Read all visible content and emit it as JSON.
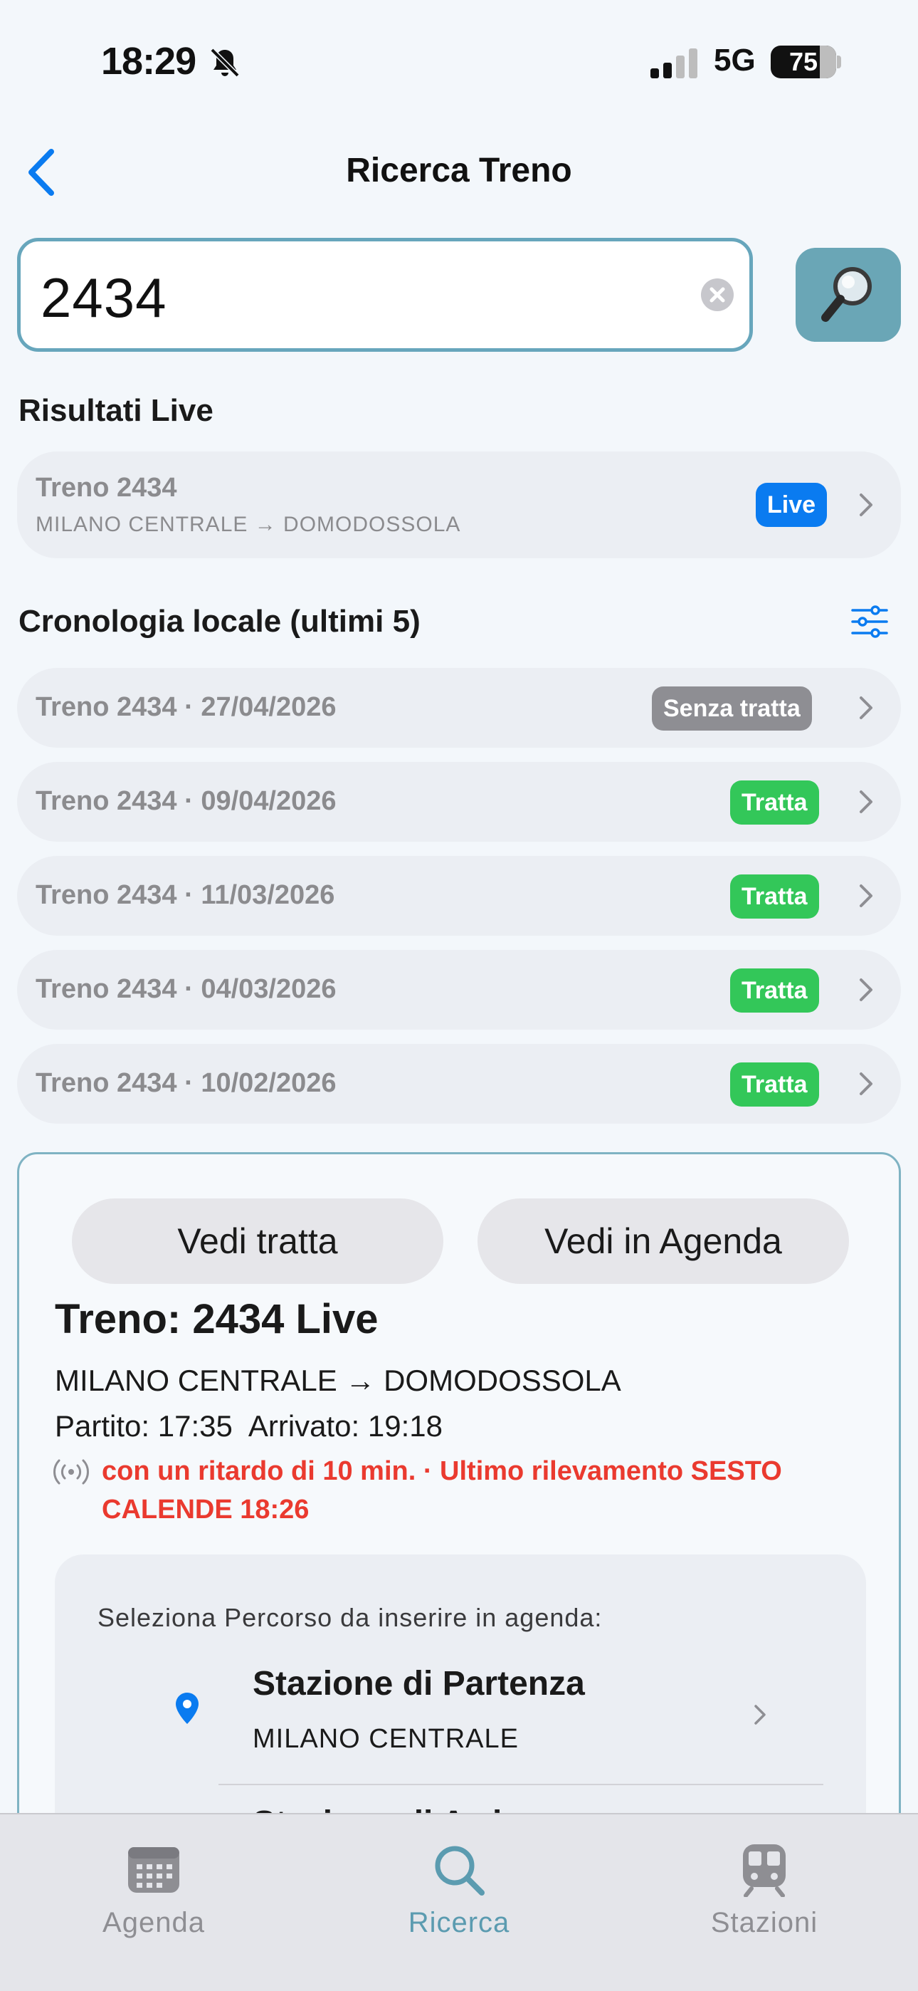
{
  "status_bar": {
    "time": "18:29",
    "network": "5G",
    "battery": "75"
  },
  "nav": {
    "title": "Ricerca Treno"
  },
  "search": {
    "value": "2434"
  },
  "live_results": {
    "title": "Risultati Live",
    "items": [
      {
        "label": "Treno 2434",
        "route": "MILANO CENTRALE → DOMODOSSOLA",
        "badge": "Live"
      }
    ]
  },
  "history": {
    "title": "Cronologia locale (ultimi 5)",
    "items": [
      {
        "label": "Treno 2434 · 27/04/2026",
        "badge": "Senza tratta"
      },
      {
        "label": "Treno 2434 · 09/04/2026",
        "badge": "Tratta"
      },
      {
        "label": "Treno 2434 · 11/03/2026",
        "badge": "Tratta"
      },
      {
        "label": "Treno 2434 · 04/03/2026",
        "badge": "Tratta"
      },
      {
        "label": "Treno 2434 · 10/02/2026",
        "badge": "Tratta"
      }
    ]
  },
  "detail": {
    "view_route_label": "Vedi tratta",
    "view_agenda_label": "Vedi in Agenda",
    "title": "Treno: 2434 Live",
    "route": "MILANO CENTRALE → DOMODOSSOLA",
    "departed": "Partito: 17:35",
    "arrived": "Arrivato: 19:18",
    "delay": "con un ritardo di 10 min. · Ultimo rilevamento SESTO CALENDE 18:26",
    "selector": {
      "title": "Seleziona Percorso da inserire in agenda:",
      "departure_label": "Stazione di Partenza",
      "departure_value": "MILANO CENTRALE",
      "arrival_label": "Stazione di Arrivo"
    }
  },
  "tabs": [
    {
      "label": "Agenda",
      "icon": "calendar-icon"
    },
    {
      "label": "Ricerca",
      "icon": "search-icon"
    },
    {
      "label": "Stazioni",
      "icon": "train-icon"
    }
  ],
  "colors": {
    "accent": "#5b9bb0",
    "live": "#0a7bf0",
    "route_ok": "#33c759",
    "no_route": "#8e8e93",
    "delay": "#ea3a2f"
  }
}
